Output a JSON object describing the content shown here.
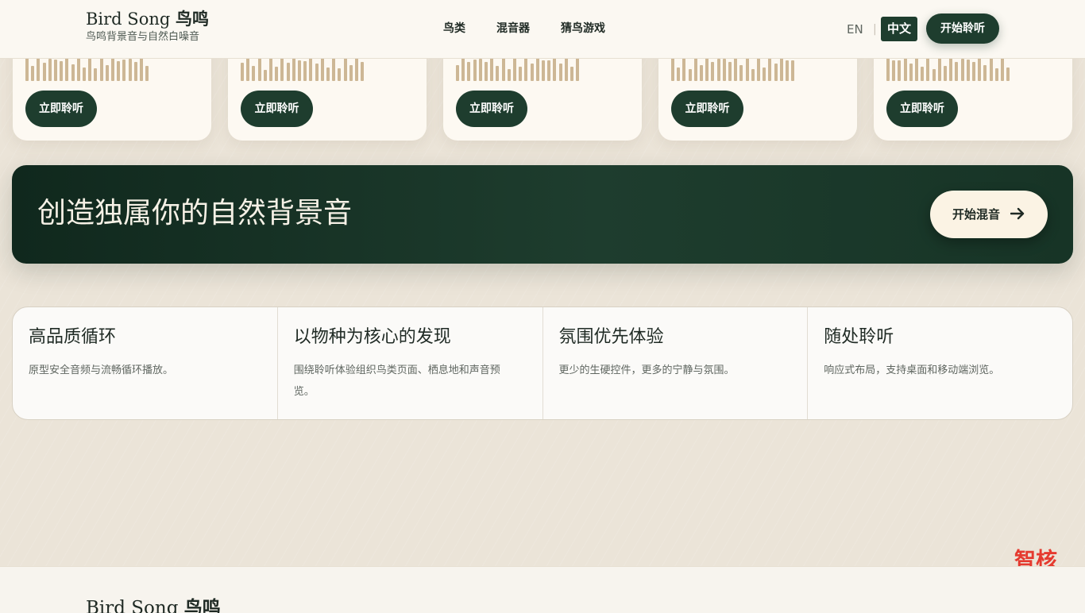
{
  "header": {
    "brand_latin": "Bird Song",
    "brand_cn": "鸟鸣",
    "tagline": "鸟鸣背景音与自然白噪音",
    "nav": [
      {
        "label": "鸟类"
      },
      {
        "label": "混音器"
      },
      {
        "label": "猜鸟游戏"
      }
    ],
    "lang_en": "EN",
    "lang_separator": "|",
    "lang_zh": "中文",
    "start_label": "开始聆听"
  },
  "cards": [
    {
      "listen_label": "立即聆听"
    },
    {
      "listen_label": "立即聆听"
    },
    {
      "listen_label": "立即聆听"
    },
    {
      "listen_label": "立即聆听"
    },
    {
      "listen_label": "立即聆听"
    }
  ],
  "banner": {
    "title": "创造独属你的自然背景音",
    "button_label": "开始混音",
    "button_icon": "arrow-right-icon"
  },
  "features": [
    {
      "title": "高品质循环",
      "desc": "原型安全音频与流畅循环播放。"
    },
    {
      "title": "以物种为核心的发现",
      "desc": "围绕聆听体验组织鸟类页面、栖息地和声音预览。"
    },
    {
      "title": "氛围优先体验",
      "desc": "更少的生硬控件，更多的宁静与氛围。"
    },
    {
      "title": "随处聆听",
      "desc": "响应式布局，支持桌面和移动端浏览。"
    }
  ],
  "watermark": "智核",
  "footer": {
    "brand_latin": "Bird Song",
    "brand_cn": "鸟鸣"
  },
  "colors": {
    "primary": "#1e3d2e",
    "accent_cream": "#fbf3e4",
    "waveform": "#cdb795",
    "watermark": "#e53a2f"
  }
}
